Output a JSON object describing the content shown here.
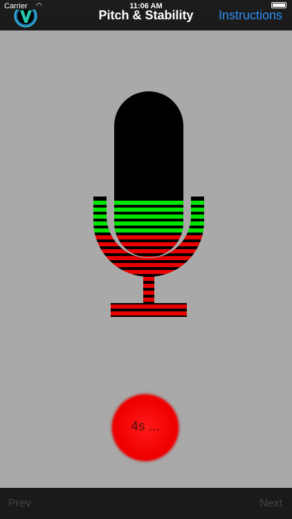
{
  "status_bar": {
    "carrier": "Carrier",
    "time": "11:06 AM",
    "wifi_icon": "wifi-icon",
    "battery_icon": "battery-icon"
  },
  "nav": {
    "logo_letter": "V",
    "title": "Pitch & Stability",
    "instructions_label": "Instructions"
  },
  "microphone": {
    "icon": "microphone-icon",
    "colors": {
      "body": "#000000",
      "green": "#00e600",
      "red": "#e60000",
      "stripe_dark": "#000000"
    }
  },
  "record_button": {
    "label": "4s ..."
  },
  "bottom": {
    "prev_label": "Prev",
    "next_label": "Next"
  },
  "colors": {
    "background": "#a9a9a9",
    "bar": "#1b1b1b",
    "accent": "#2f8ff2",
    "disabled_text": "#444444",
    "record": "#f00000"
  }
}
